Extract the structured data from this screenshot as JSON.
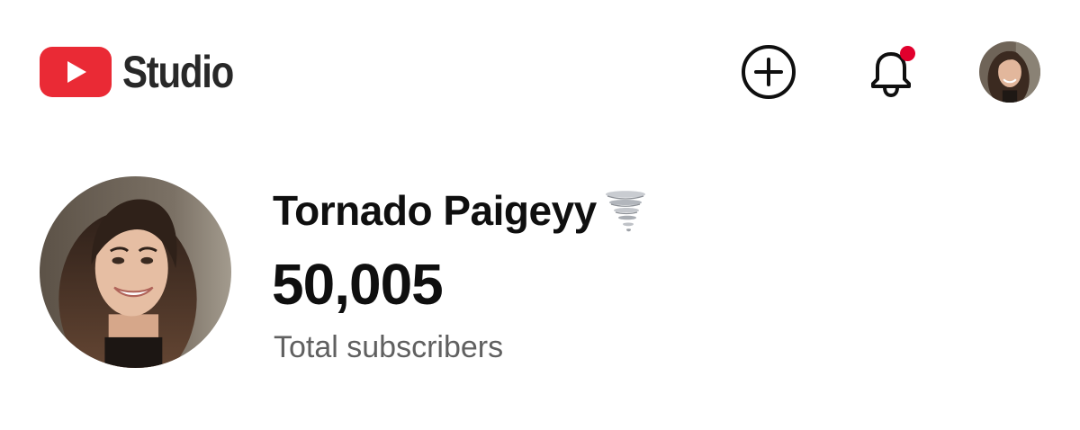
{
  "header": {
    "app_name": "Studio",
    "brand_color": "#ff0000",
    "notification_dot_color": "#e1002d",
    "create_icon": "create-plus-circle-icon",
    "notifications_icon": "bell-icon",
    "account_avatar": "account-avatar"
  },
  "channel": {
    "name": "Tornado Paigeyy",
    "name_emoji": "tornado-emoji",
    "subscriber_count": "50,005",
    "subscriber_label": "Total subscribers"
  }
}
